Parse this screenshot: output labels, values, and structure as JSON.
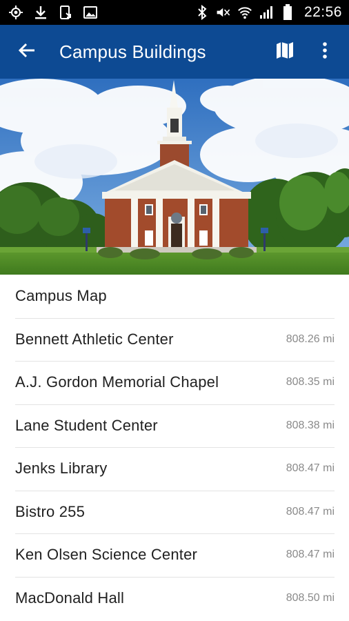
{
  "status_bar": {
    "time": "22:56",
    "left_icons": [
      "location-icon",
      "download-icon",
      "phone-sync-icon",
      "image-icon"
    ],
    "right_icons": [
      "bluetooth-icon",
      "mute-icon",
      "wifi-icon",
      "signal-icon",
      "battery-icon"
    ]
  },
  "app_bar": {
    "title": "Campus Buildings",
    "back_icon": "arrow-back-icon",
    "map_icon": "map-icon",
    "overflow_icon": "more-vert-icon",
    "color": "#0d4a93"
  },
  "hero": {
    "description_icon": "chapel-photo"
  },
  "list": {
    "items": [
      {
        "name": "Campus Map",
        "distance": ""
      },
      {
        "name": "Bennett Athletic Center",
        "distance": "808.26 mi"
      },
      {
        "name": "A.J. Gordon Memorial Chapel",
        "distance": "808.35 mi"
      },
      {
        "name": "Lane Student Center",
        "distance": "808.38 mi"
      },
      {
        "name": "Jenks Library",
        "distance": "808.47 mi"
      },
      {
        "name": "Bistro 255",
        "distance": "808.47 mi"
      },
      {
        "name": "Ken Olsen Science Center",
        "distance": "808.47 mi"
      },
      {
        "name": "MacDonald Hall",
        "distance": "808.50 mi"
      }
    ]
  }
}
